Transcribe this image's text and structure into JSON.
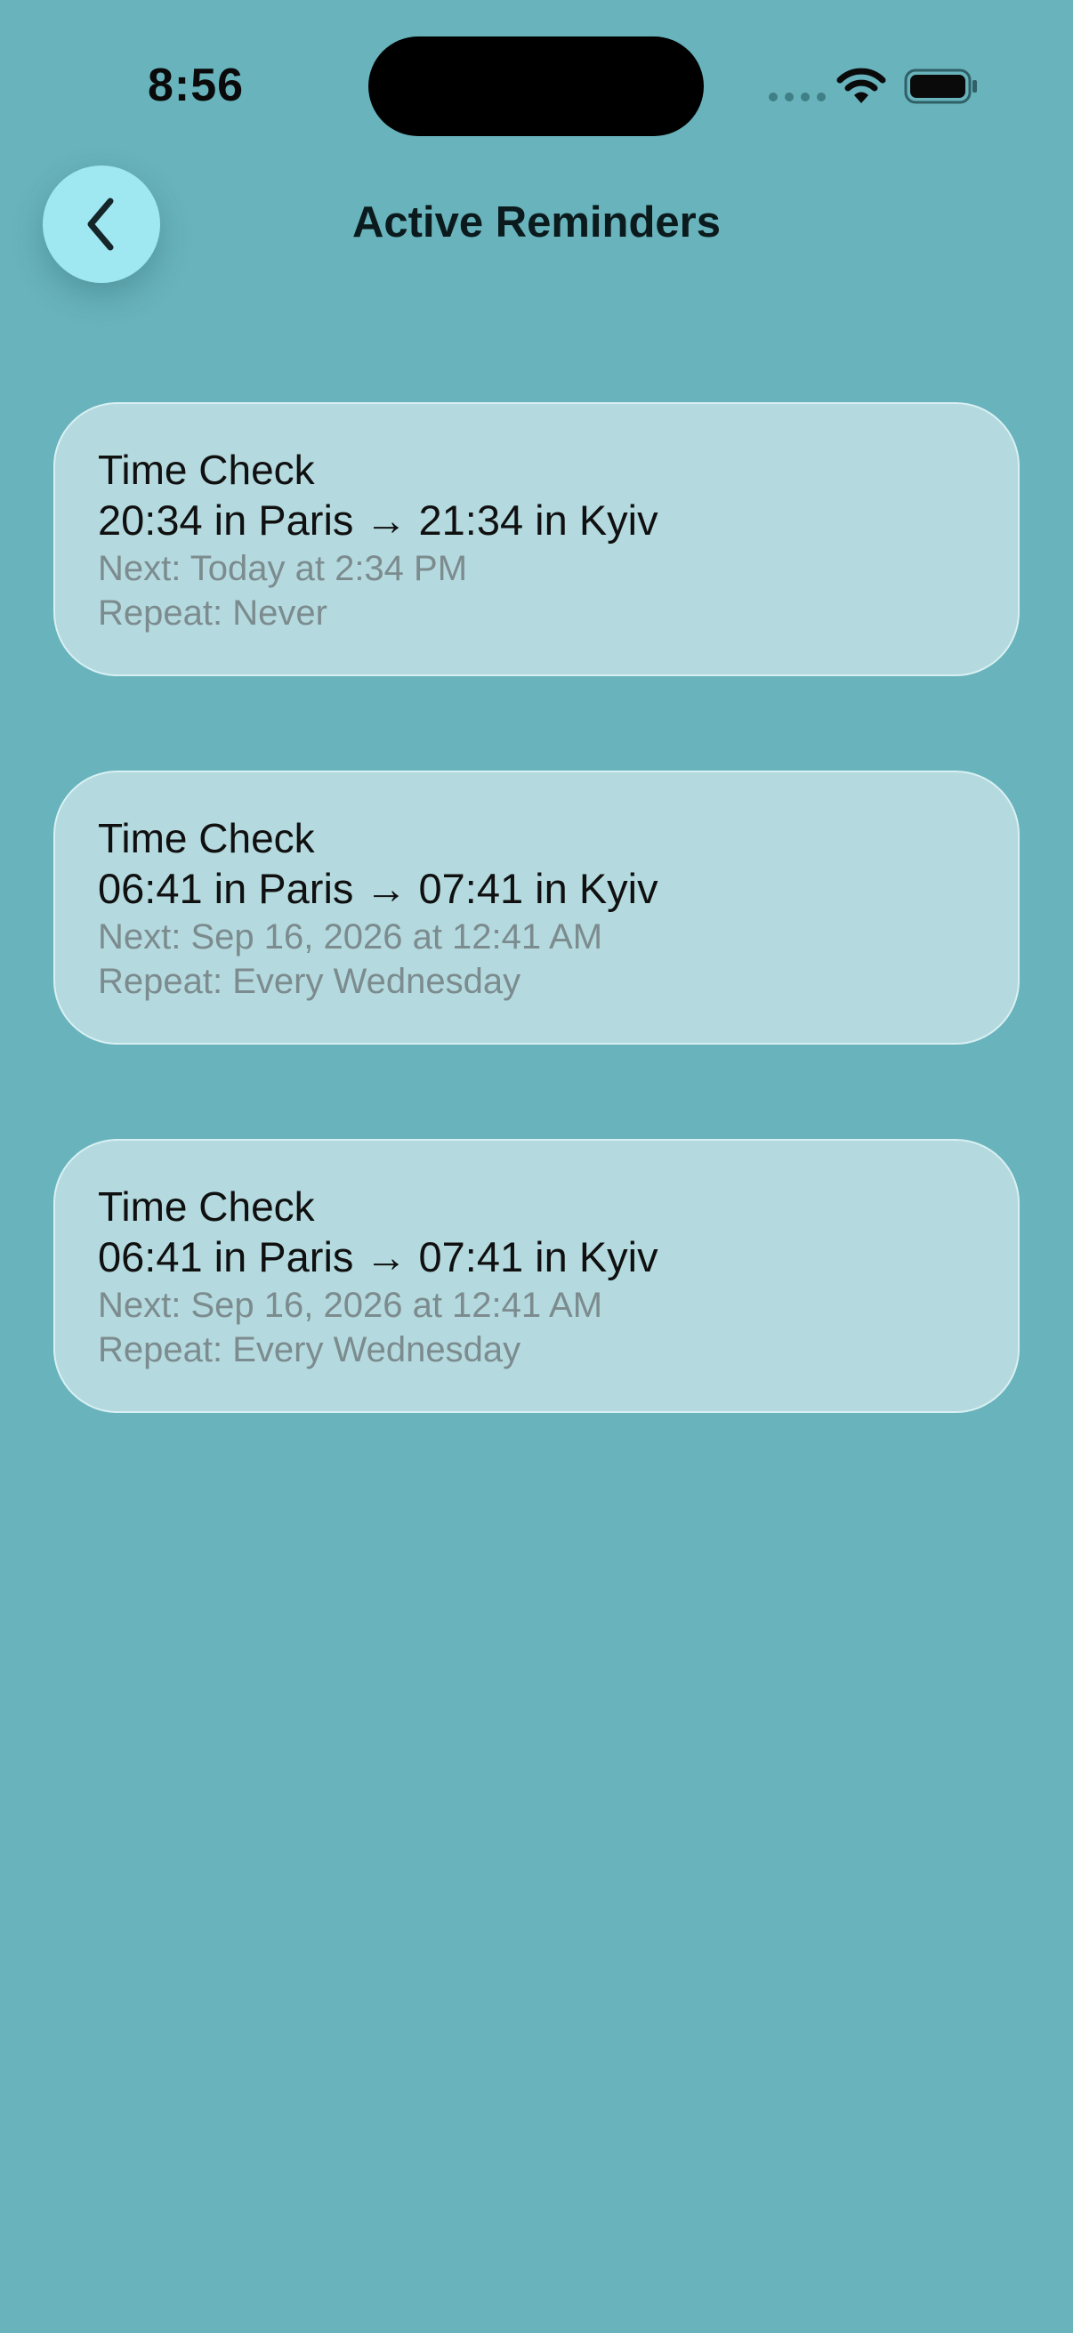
{
  "status_bar": {
    "time": "8:56"
  },
  "header": {
    "title": "Active Reminders"
  },
  "reminders": [
    {
      "title": "Time Check",
      "times": "20:34 in Paris → 21:34 in Kyiv",
      "next": "Next: Today at 2:34 PM",
      "repeat": "Repeat: Never"
    },
    {
      "title": "Time Check",
      "times": "06:41 in Paris → 07:41 in Kyiv",
      "next": "Next: Sep 16, 2026 at 12:41 AM",
      "repeat": "Repeat: Every Wednesday"
    },
    {
      "title": "Time Check",
      "times": "06:41 in Paris → 07:41 in Kyiv",
      "next": "Next: Sep 16, 2026 at 12:41 AM",
      "repeat": "Repeat: Every Wednesday"
    }
  ],
  "icons": {
    "back": "chevron-left-icon",
    "wifi": "wifi-icon",
    "battery": "battery-icon",
    "cellular": "cellular-signal-icon"
  },
  "colors": {
    "background": "#68b3bc",
    "card": "#b4dadf",
    "back_button": "#9fe8f1"
  }
}
